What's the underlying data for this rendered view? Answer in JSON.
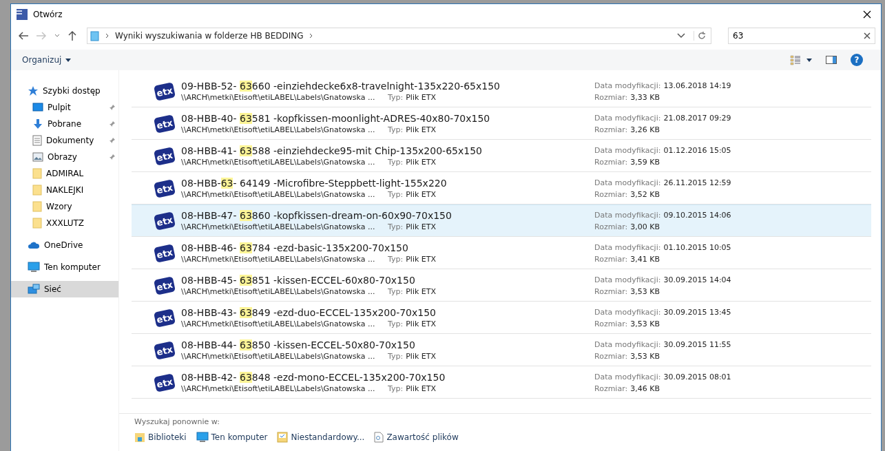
{
  "window": {
    "title": "Otwórz"
  },
  "address": {
    "breadcrumb": "Wyniki wyszukiwania w folderze HB BEDDING"
  },
  "search": {
    "value": "63"
  },
  "toolbar": {
    "organize": "Organizuj",
    "help": "?"
  },
  "sidebar": {
    "items": [
      {
        "kind": "star",
        "label": "Szybki dostęp",
        "pinned": false,
        "selected": false
      },
      {
        "kind": "desktop",
        "label": "Pulpit",
        "pinned": true,
        "selected": false
      },
      {
        "kind": "download",
        "label": "Pobrane",
        "pinned": true,
        "selected": false
      },
      {
        "kind": "document",
        "label": "Dokumenty",
        "pinned": true,
        "selected": false
      },
      {
        "kind": "pictures",
        "label": "Obrazy",
        "pinned": true,
        "selected": false
      },
      {
        "kind": "folder",
        "label": "ADMIRAL",
        "pinned": false,
        "selected": false
      },
      {
        "kind": "folder",
        "label": "NAKLEJKI",
        "pinned": false,
        "selected": false
      },
      {
        "kind": "folder",
        "label": "Wzory",
        "pinned": false,
        "selected": false
      },
      {
        "kind": "folder",
        "label": "XXXLUTZ",
        "pinned": false,
        "selected": false
      },
      {
        "kind": "cloud",
        "label": "OneDrive",
        "pinned": false,
        "selected": false
      },
      {
        "kind": "computer",
        "label": "Ten komputer",
        "pinned": false,
        "selected": false
      },
      {
        "kind": "network",
        "label": "Sieć",
        "pinned": false,
        "selected": true
      }
    ]
  },
  "files": [
    {
      "icon_label": "etx",
      "name_start": "09-HBB-52- ",
      "name_match": "63",
      "name_end": "660 -einziehdecke6x8-travelnight-135x220-65x150",
      "path": "\\\\ARCH\\metki\\Etisoft\\etiLABEL\\Labels\\Gnatowska ...",
      "type_label": "Typ:",
      "type": "Plik ETX",
      "date_label": "Data modyfikacji:",
      "date": "13.06.2018 14:19",
      "size_label": "Rozmiar:",
      "size": "3,33 KB",
      "selected": false
    },
    {
      "icon_label": "etx",
      "name_start": "08-HBB-40- ",
      "name_match": "63",
      "name_end": "581 -kopfkissen-moonlight-ADRES-40x80-70x150",
      "path": "\\\\ARCH\\metki\\Etisoft\\etiLABEL\\Labels\\Gnatowska ...",
      "type_label": "Typ:",
      "type": "Plik ETX",
      "date_label": "Data modyfikacji:",
      "date": "21.08.2017 09:29",
      "size_label": "Rozmiar:",
      "size": "3,26 KB",
      "selected": false
    },
    {
      "icon_label": "etx",
      "name_start": "08-HBB-41- ",
      "name_match": "63",
      "name_end": "588 -einziehdecke95-mit Chip-135x200-65x150",
      "path": "\\\\ARCH\\metki\\Etisoft\\etiLABEL\\Labels\\Gnatowska ...",
      "type_label": "Typ:",
      "type": "Plik ETX",
      "date_label": "Data modyfikacji:",
      "date": "01.12.2016 15:05",
      "size_label": "Rozmiar:",
      "size": "3,59 KB",
      "selected": false
    },
    {
      "icon_label": "etx",
      "name_start": "08-HBB-",
      "name_match": "63",
      "name_end": "- 64149 -Microfibre-Steppbett-light-155x220",
      "path": "\\\\ARCH\\metki\\Etisoft\\etiLABEL\\Labels\\Gnatowska ...",
      "type_label": "Typ:",
      "type": "Plik ETX",
      "date_label": "Data modyfikacji:",
      "date": "26.11.2015 12:59",
      "size_label": "Rozmiar:",
      "size": "3,52 KB",
      "selected": false
    },
    {
      "icon_label": "etx",
      "name_start": "08-HBB-47- ",
      "name_match": "63",
      "name_end": "860 -kopfkissen-dream-on-60x90-70x150",
      "path": "\\\\ARCH\\metki\\Etisoft\\etiLABEL\\Labels\\Gnatowska ...",
      "type_label": "Typ:",
      "type": "Plik ETX",
      "date_label": "Data modyfikacji:",
      "date": "09.10.2015 14:06",
      "size_label": "Rozmiar:",
      "size": "3,00 KB",
      "selected": true
    },
    {
      "icon_label": "etx",
      "name_start": "08-HBB-46- ",
      "name_match": "63",
      "name_end": "784 -ezd-basic-135x200-70x150",
      "path": "\\\\ARCH\\metki\\Etisoft\\etiLABEL\\Labels\\Gnatowska ...",
      "type_label": "Typ:",
      "type": "Plik ETX",
      "date_label": "Data modyfikacji:",
      "date": "01.10.2015 10:05",
      "size_label": "Rozmiar:",
      "size": "3,41 KB",
      "selected": false
    },
    {
      "icon_label": "etx",
      "name_start": "08-HBB-45- ",
      "name_match": "63",
      "name_end": "851 -kissen-ECCEL-60x80-70x150",
      "path": "\\\\ARCH\\metki\\Etisoft\\etiLABEL\\Labels\\Gnatowska ...",
      "type_label": "Typ:",
      "type": "Plik ETX",
      "date_label": "Data modyfikacji:",
      "date": "30.09.2015 14:04",
      "size_label": "Rozmiar:",
      "size": "3,53 KB",
      "selected": false
    },
    {
      "icon_label": "etx",
      "name_start": "08-HBB-43- ",
      "name_match": "63",
      "name_end": "849 -ezd-duo-ECCEL-135x200-70x150",
      "path": "\\\\ARCH\\metki\\Etisoft\\etiLABEL\\Labels\\Gnatowska ...",
      "type_label": "Typ:",
      "type": "Plik ETX",
      "date_label": "Data modyfikacji:",
      "date": "30.09.2015 13:45",
      "size_label": "Rozmiar:",
      "size": "3,53 KB",
      "selected": false
    },
    {
      "icon_label": "etx",
      "name_start": "08-HBB-44- ",
      "name_match": "63",
      "name_end": "850 -kissen-ECCEL-50x80-70x150",
      "path": "\\\\ARCH\\metki\\Etisoft\\etiLABEL\\Labels\\Gnatowska ...",
      "type_label": "Typ:",
      "type": "Plik ETX",
      "date_label": "Data modyfikacji:",
      "date": "30.09.2015 11:55",
      "size_label": "Rozmiar:",
      "size": "3,53 KB",
      "selected": false
    },
    {
      "icon_label": "etx",
      "name_start": "08-HBB-42- ",
      "name_match": "63",
      "name_end": "848 -ezd-mono-ECCEL-135x200-70x150",
      "path": "\\\\ARCH\\metki\\Etisoft\\etiLABEL\\Labels\\Gnatowska ...",
      "type_label": "Typ:",
      "type": "Plik ETX",
      "date_label": "Data modyfikacji:",
      "date": "30.09.2015 08:01",
      "size_label": "Rozmiar:",
      "size": "3,46 KB",
      "selected": false
    }
  ],
  "search_again": {
    "label": "Wyszukaj ponownie w:",
    "options": [
      {
        "kind": "libraries",
        "label": "Biblioteki"
      },
      {
        "kind": "computer",
        "label": "Ten komputer"
      },
      {
        "kind": "custom",
        "label": "Niestandardowy..."
      },
      {
        "kind": "contents",
        "label": "Zawartość plików"
      }
    ]
  }
}
